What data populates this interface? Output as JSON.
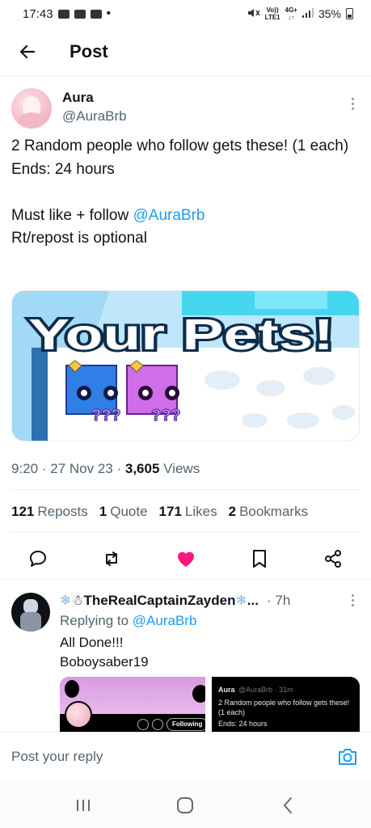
{
  "status_bar": {
    "time": "17:43",
    "network_top": "Vo))",
    "network_bottom": "LTE1",
    "signal_top": "4G+",
    "battery": "35%"
  },
  "header": {
    "title": "Post"
  },
  "tweet": {
    "author_name": "Aura",
    "author_handle": "@AuraBrb",
    "text_line1": "2 Random people who follow gets these! (1 each)",
    "text_line2": "Ends: 24 hours",
    "text_line3_prefix": "Must like + follow ",
    "text_line3_mention": "@AuraBrb",
    "text_line4": "Rt/repost is optional",
    "media": {
      "title": "Your Pets!",
      "pet1_label": "???",
      "pet2_label": "???"
    },
    "time": "9:20",
    "date": "27 Nov 23",
    "views_count": "3,605",
    "views_label": "Views",
    "separator": "·",
    "stats": {
      "reposts_count": "121",
      "reposts_label": "Reposts",
      "quotes_count": "1",
      "quotes_label": "Quote",
      "likes_count": "171",
      "likes_label": "Likes",
      "bookmarks_count": "2",
      "bookmarks_label": "Bookmarks"
    },
    "liked": true,
    "like_color": "#f91880"
  },
  "reply": {
    "name": "TheRealCaptainZayden",
    "name_suffix": "...",
    "time": "· 7h",
    "replying_prefix": "Replying to ",
    "replying_to": "@AuraBrb",
    "line1": "All Done!!!",
    "line2": "Boboysaber19",
    "media_following": "Following",
    "media_name": "Aura",
    "media_handle": "@AuraBrb · 31m",
    "media_text1": "2 Random people who follow gets these! (1 each)",
    "media_text2": "Ends: 24 hours"
  },
  "composer": {
    "placeholder": "Post your reply"
  },
  "colors": {
    "accent": "#1d9bf0",
    "text": "#0f1419",
    "muted": "#536471"
  }
}
